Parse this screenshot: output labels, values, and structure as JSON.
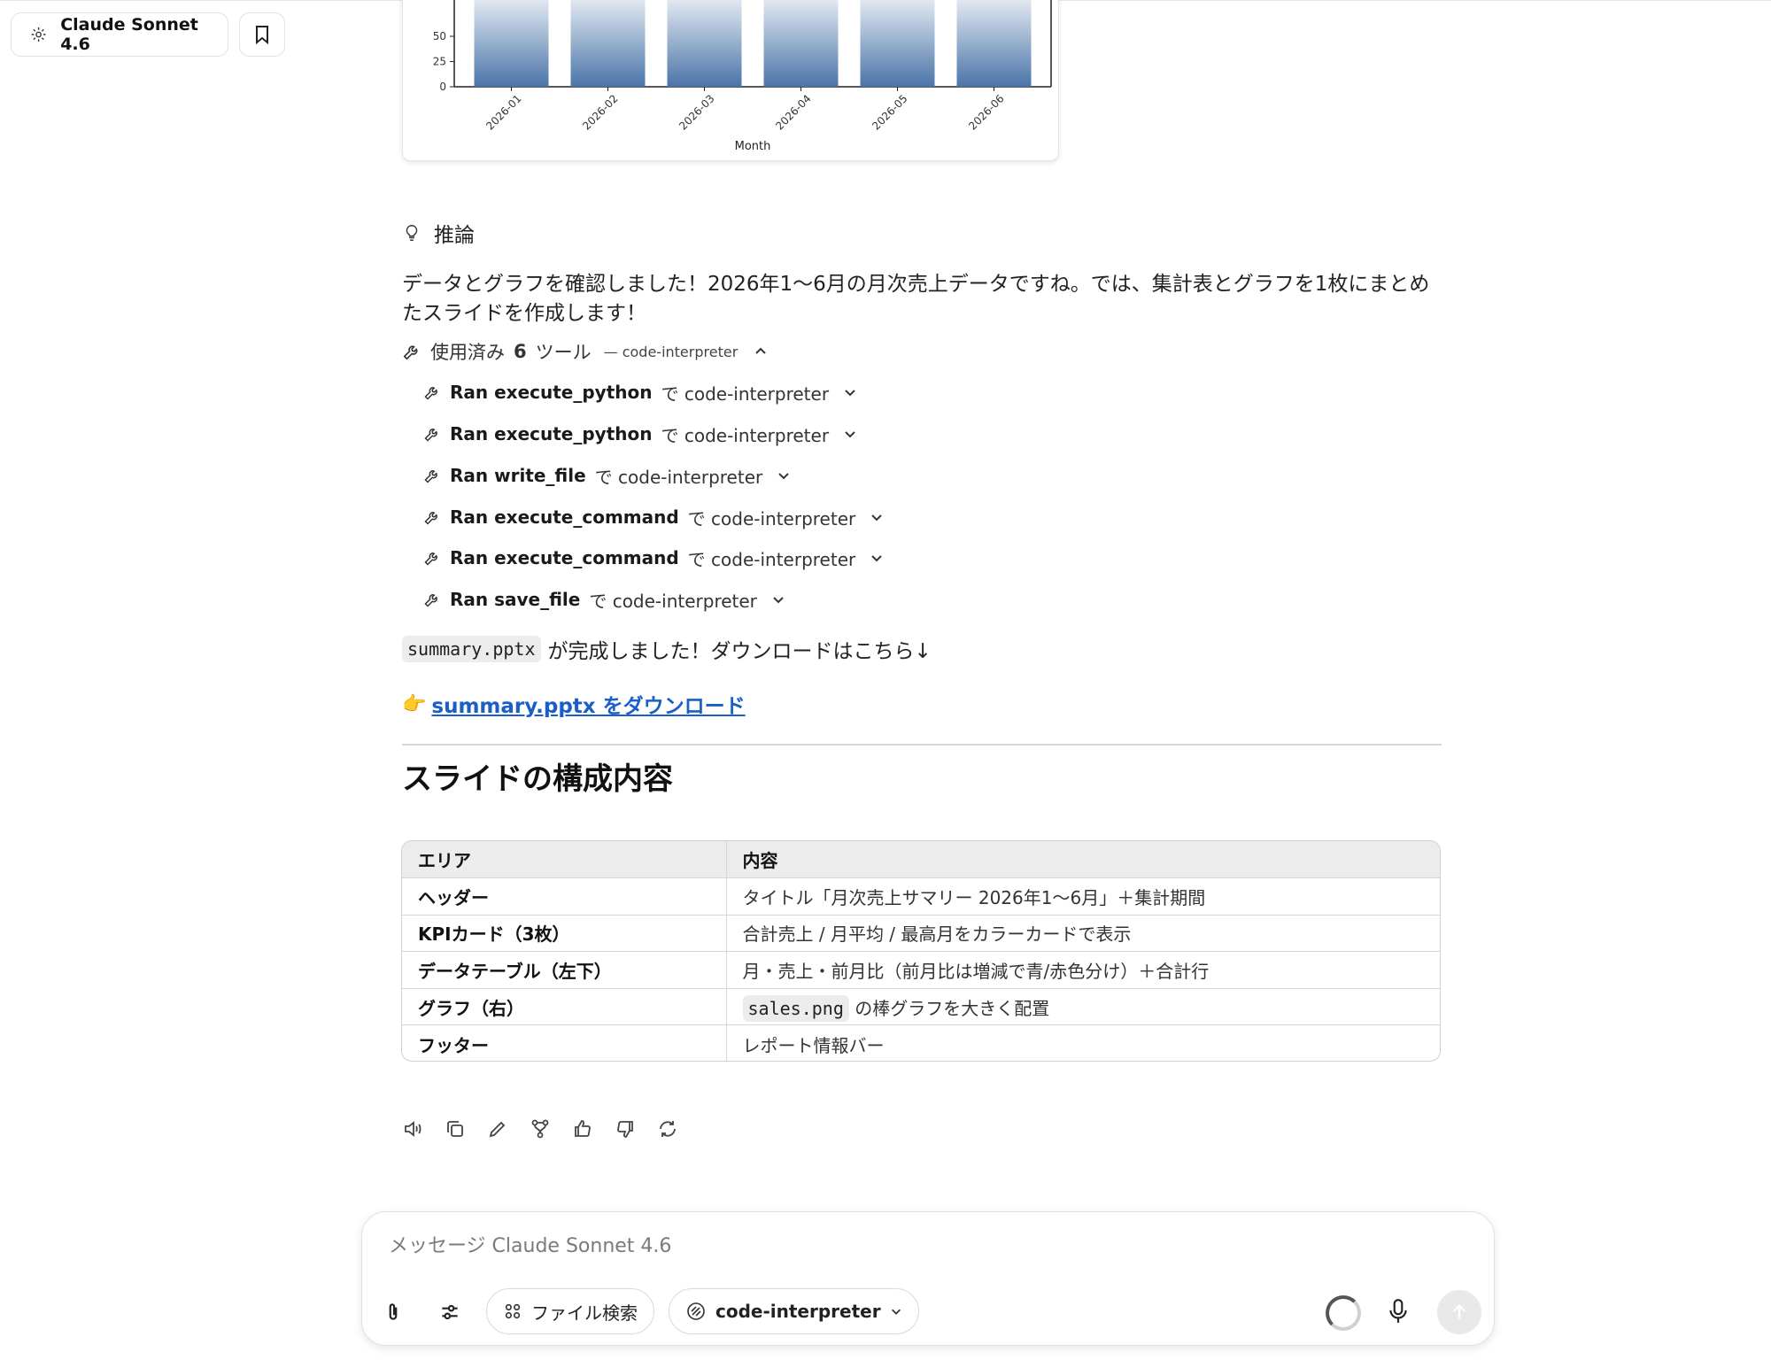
{
  "header": {
    "model_name": "Claude Sonnet 4.6"
  },
  "chart_data": {
    "type": "bar",
    "categories": [
      "2026-01",
      "2026-02",
      "2026-03",
      "2026-04",
      "2026-05",
      "2026-06"
    ],
    "visible_y_ticks": [
      0,
      25,
      50
    ],
    "xlabel": "Month",
    "bar_color": "#4a74a8"
  },
  "message": {
    "reasoning_label": "推論",
    "paragraph": "データとグラフを確認しました！2026年1〜6月の月次売上データですね。では、集計表とグラフを1枚にまとめたスライドを作成します！",
    "tools_header": {
      "prefix": "使用済み",
      "count": "6",
      "suffix": "ツール",
      "server": "— code-interpreter"
    },
    "tools": [
      {
        "name": "Ran execute_python",
        "via": "で code-interpreter"
      },
      {
        "name": "Ran execute_python",
        "via": "で code-interpreter"
      },
      {
        "name": "Ran write_file",
        "via": "で code-interpreter"
      },
      {
        "name": "Ran execute_command",
        "via": "で code-interpreter"
      },
      {
        "name": "Ran execute_command",
        "via": "で code-interpreter"
      },
      {
        "name": "Ran save_file",
        "via": "で code-interpreter"
      }
    ],
    "done_code": "summary.pptx",
    "done_text": "が完成しました！ダウンロードはこちら↓",
    "download_emoji": "👉",
    "download_link": "summary.pptx をダウンロード",
    "section_title": "スライドの構成内容",
    "table": {
      "headers": [
        "エリア",
        "内容"
      ],
      "rows": [
        {
          "area": "ヘッダー",
          "content": "タイトル「月次売上サマリー 2026年1〜6月」＋集計期間"
        },
        {
          "area": "KPIカード（3枚）",
          "content": "合計売上 / 月平均 / 最高月をカラーカードで表示"
        },
        {
          "area": "データテーブル（左下）",
          "content": "月・売上・前月比（前月比は増減で青/赤色分け）＋合計行"
        },
        {
          "area": "グラフ（右）",
          "content_code": "sales.png",
          "content": "の棒グラフを大きく配置"
        },
        {
          "area": "フッター",
          "content": "レポート情報バー"
        }
      ]
    }
  },
  "composer": {
    "placeholder": "メッセージ Claude Sonnet 4.6",
    "file_search_label": "ファイル検索",
    "tool_label": "code-interpreter"
  }
}
